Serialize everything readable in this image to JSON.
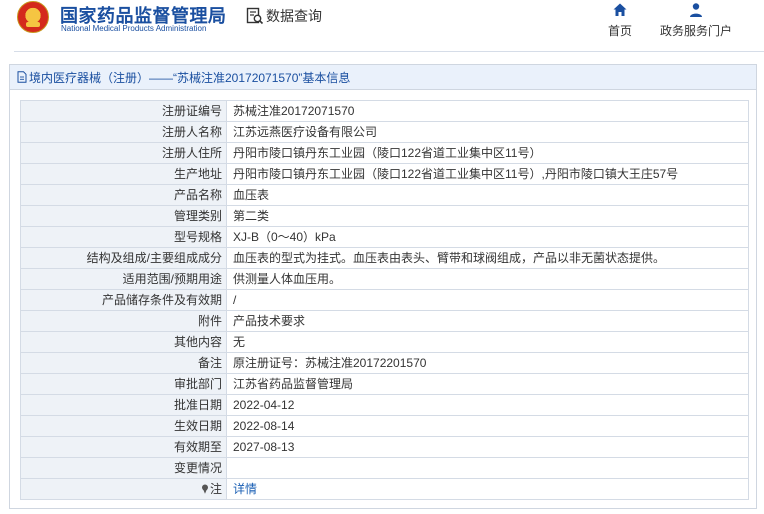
{
  "header": {
    "title": "国家药品监督管理局",
    "subtitle": "National Medical Products Administration",
    "data_query": "数据查询",
    "nav": {
      "home": "首页",
      "service": "政务服务门户"
    }
  },
  "breadcrumb": "境内医疗器械（注册）——“苏械注准20172071570”基本信息",
  "rows": [
    {
      "label": "注册证编号",
      "value": "苏械注准20172071570"
    },
    {
      "label": "注册人名称",
      "value": "江苏远燕医疗设备有限公司"
    },
    {
      "label": "注册人住所",
      "value": "丹阳市陵口镇丹东工业园（陵口122省道工业集中区11号）"
    },
    {
      "label": "生产地址",
      "value": "丹阳市陵口镇丹东工业园（陵口122省道工业集中区11号）,丹阳市陵口镇大王庄57号"
    },
    {
      "label": "产品名称",
      "value": "血压表"
    },
    {
      "label": "管理类别",
      "value": "第二类"
    },
    {
      "label": "型号规格",
      "value": "XJ-B（0～40）kPa"
    },
    {
      "label": "结构及组成/主要组成成分",
      "value": "血压表的型式为挂式。血压表由表头、臂带和球阀组成，产品以非无菌状态提供。"
    },
    {
      "label": "适用范围/预期用途",
      "value": "供测量人体血压用。"
    },
    {
      "label": "产品储存条件及有效期",
      "value": "/"
    },
    {
      "label": "附件",
      "value": "产品技术要求"
    },
    {
      "label": "其他内容",
      "value": "无"
    },
    {
      "label": "备注",
      "value": "原注册证号：苏械注准20172201570"
    },
    {
      "label": "审批部门",
      "value": "江苏省药品监督管理局"
    },
    {
      "label": "批准日期",
      "value": "2022-04-12"
    },
    {
      "label": "生效日期",
      "value": "2022-08-14"
    },
    {
      "label": "有效期至",
      "value": "2027-08-13"
    },
    {
      "label": "变更情况",
      "value": ""
    }
  ],
  "note_row": {
    "label": "注",
    "link": "详情"
  },
  "icons": {
    "emblem": "national-emblem-icon",
    "data_query": "document-search-icon",
    "home": "home-icon",
    "service": "user-icon",
    "breadcrumb": "document-icon",
    "note": "pin-icon"
  },
  "colors": {
    "brand": "#1a4fa0",
    "link": "#1a5fb4",
    "label_bg": "#eef2f7",
    "head_bg": "#eaf1fb"
  }
}
